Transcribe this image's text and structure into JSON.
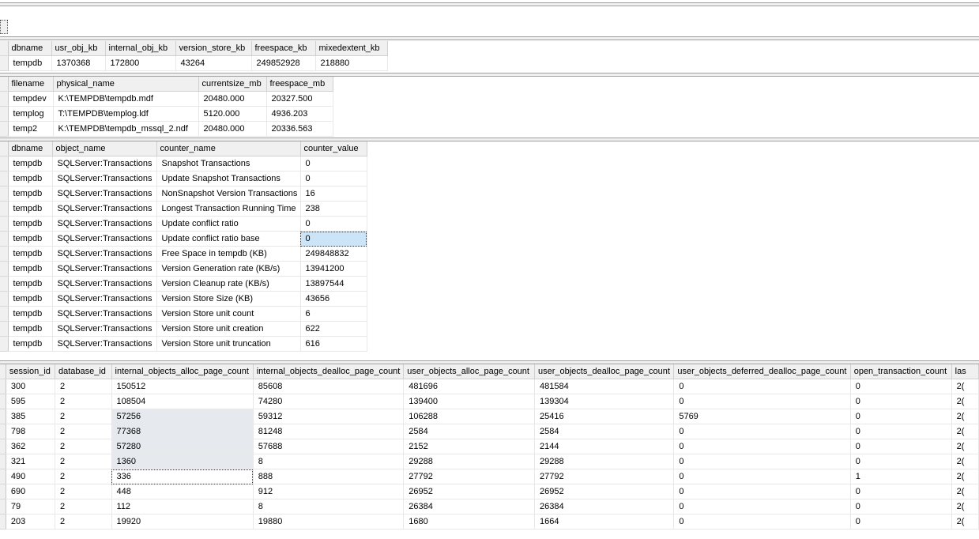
{
  "grid1": {
    "columns": [],
    "rows": []
  },
  "grid2": {
    "columns": [
      "dbname",
      "usr_obj_kb",
      "internal_obj_kb",
      "version_store_kb",
      "freespace_kb",
      "mixedextent_kb"
    ],
    "rows": [
      [
        "tempdb",
        "1370368",
        "172800",
        "43264",
        "249852928",
        "218880"
      ]
    ]
  },
  "grid3": {
    "columns": [
      "filename",
      "physical_name",
      "currentsize_mb",
      "freespace_mb"
    ],
    "rows": [
      [
        "tempdev",
        "K:\\TEMPDB\\tempdb.mdf",
        "20480.000",
        "20327.500"
      ],
      [
        "templog",
        "T:\\TEMPDB\\templog.ldf",
        "5120.000",
        "4936.203"
      ],
      [
        "temp2",
        "K:\\TEMPDB\\tempdb_mssql_2.ndf",
        "20480.000",
        "20336.563"
      ]
    ]
  },
  "grid4": {
    "columns": [
      "dbname",
      "object_name",
      "counter_name",
      "counter_value"
    ],
    "rows": [
      [
        "tempdb",
        "SQLServer:Transactions",
        "Snapshot Transactions",
        "0"
      ],
      [
        "tempdb",
        "SQLServer:Transactions",
        "Update Snapshot Transactions",
        "0"
      ],
      [
        "tempdb",
        "SQLServer:Transactions",
        "NonSnapshot Version Transactions",
        "16"
      ],
      [
        "tempdb",
        "SQLServer:Transactions",
        "Longest Transaction Running Time",
        "238"
      ],
      [
        "tempdb",
        "SQLServer:Transactions",
        "Update conflict ratio",
        "0"
      ],
      [
        "tempdb",
        "SQLServer:Transactions",
        "Update conflict ratio base",
        "0"
      ],
      [
        "tempdb",
        "SQLServer:Transactions",
        "Free Space in tempdb (KB)",
        "249848832"
      ],
      [
        "tempdb",
        "SQLServer:Transactions",
        "Version Generation rate (KB/s)",
        "13941200"
      ],
      [
        "tempdb",
        "SQLServer:Transactions",
        "Version Cleanup rate (KB/s)",
        "13897544"
      ],
      [
        "tempdb",
        "SQLServer:Transactions",
        "Version Store Size (KB)",
        "43656"
      ],
      [
        "tempdb",
        "SQLServer:Transactions",
        "Version Store unit count",
        "6"
      ],
      [
        "tempdb",
        "SQLServer:Transactions",
        "Version Store unit creation",
        "622"
      ],
      [
        "tempdb",
        "SQLServer:Transactions",
        "Version Store unit truncation",
        "616"
      ]
    ]
  },
  "grid5": {
    "columns": [
      "session_id",
      "database_id",
      "internal_objects_alloc_page_count",
      "internal_objects_dealloc_page_count",
      "user_objects_alloc_page_count",
      "user_objects_dealloc_page_count",
      "user_objects_deferred_dealloc_page_count",
      "open_transaction_count",
      "las"
    ],
    "rows": [
      [
        "300",
        "2",
        "150512",
        "85608",
        "481696",
        "481584",
        "0",
        "0",
        "2("
      ],
      [
        "595",
        "2",
        "108504",
        "74280",
        "139400",
        "139304",
        "0",
        "0",
        "2("
      ],
      [
        "385",
        "2",
        "57256",
        "59312",
        "106288",
        "25416",
        "5769",
        "0",
        "2("
      ],
      [
        "798",
        "2",
        "77368",
        "81248",
        "2584",
        "2584",
        "0",
        "0",
        "2("
      ],
      [
        "362",
        "2",
        "57280",
        "57688",
        "2152",
        "2144",
        "0",
        "0",
        "2("
      ],
      [
        "321",
        "2",
        "1360",
        "8",
        "29288",
        "29288",
        "0",
        "0",
        "2("
      ],
      [
        "490",
        "2",
        "336",
        "888",
        "27792",
        "27792",
        "0",
        "1",
        "2("
      ],
      [
        "690",
        "2",
        "448",
        "912",
        "26952",
        "26952",
        "0",
        "0",
        "2("
      ],
      [
        "79",
        "2",
        "112",
        "8",
        "26384",
        "26384",
        "0",
        "0",
        "2("
      ],
      [
        "203",
        "2",
        "19920",
        "19880",
        "1680",
        "1664",
        "0",
        "0",
        "2("
      ]
    ]
  }
}
